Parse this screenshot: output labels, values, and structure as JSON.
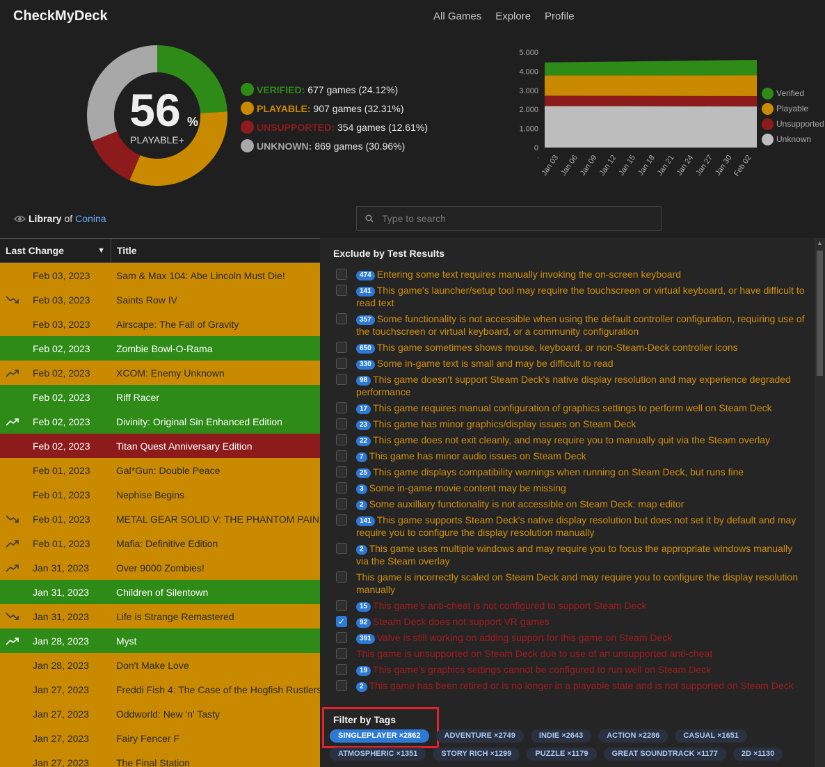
{
  "header": {
    "brand": "CheckMyDeck",
    "nav": [
      "All Games",
      "Explore",
      "Profile"
    ]
  },
  "summary": {
    "percent": "56",
    "percent_sign": "%",
    "label": "PLAYABLE+",
    "stats": [
      {
        "label": "VERIFIED:",
        "value": "677 games (24.12%)",
        "color": "#2e8b17"
      },
      {
        "label": "PLAYABLE:",
        "value": "907 games (32.31%)",
        "color": "#c98a00"
      },
      {
        "label": "UNSUPPORTED:",
        "value": "354 games (12.61%)",
        "color": "#8e1b1b"
      },
      {
        "label": "UNKNOWN:",
        "value": "869 games (30.96%)",
        "color": "#a8a8a8"
      }
    ]
  },
  "chart_data": {
    "type": "area",
    "stacked": true,
    "x": [
      "Jan 03",
      "Jan 06",
      "Jan 09",
      "Jan 12",
      "Jan 15",
      "Jan 18",
      "Jan 21",
      "Jan 24",
      "Jan 27",
      "Jan 30",
      "Feb 02"
    ],
    "yticks": [
      "5.000",
      "4.000",
      "3.000",
      "2.000",
      "1.000",
      "0"
    ],
    "ylim": [
      0,
      5000
    ],
    "series": [
      {
        "name": "Unknown",
        "color": "#bdbdbd",
        "start": 2180,
        "end": 2160
      },
      {
        "name": "Unsupported",
        "color": "#8e1b1b",
        "start": 540,
        "end": 540
      },
      {
        "name": "Playable",
        "color": "#c98a00",
        "start": 1060,
        "end": 1090
      },
      {
        "name": "Verified",
        "color": "#2e8b17",
        "start": 680,
        "end": 810
      }
    ],
    "legend": [
      "Verified",
      "Playable",
      "Unsupported",
      "Unknown"
    ]
  },
  "library": {
    "prefix": "Library",
    "of": "of",
    "owner": "Conina"
  },
  "search": {
    "placeholder": "Type to search"
  },
  "table": {
    "col_date": "Last Change",
    "col_title": "Title",
    "rows": [
      {
        "date": "Feb 03, 2023",
        "title": "Sam & Max 104: Abe Lincoln Must Die!",
        "status": "playable",
        "trend": ""
      },
      {
        "date": "Feb 03, 2023",
        "title": "Saints Row IV",
        "status": "playable",
        "trend": "down"
      },
      {
        "date": "Feb 03, 2023",
        "title": "Airscape: The Fall of Gravity",
        "status": "playable",
        "trend": ""
      },
      {
        "date": "Feb 02, 2023",
        "title": "Zombie Bowl-O-Rama",
        "status": "verified",
        "trend": ""
      },
      {
        "date": "Feb 02, 2023",
        "title": "XCOM: Enemy Unknown",
        "status": "playable",
        "trend": "up"
      },
      {
        "date": "Feb 02, 2023",
        "title": "Riff Racer",
        "status": "verified",
        "trend": ""
      },
      {
        "date": "Feb 02, 2023",
        "title": "Divinity: Original Sin Enhanced Edition",
        "status": "verified",
        "trend": "up"
      },
      {
        "date": "Feb 02, 2023",
        "title": "Titan Quest Anniversary Edition",
        "status": "unsupported",
        "trend": ""
      },
      {
        "date": "Feb 01, 2023",
        "title": "Gal*Gun: Double Peace",
        "status": "playable",
        "trend": ""
      },
      {
        "date": "Feb 01, 2023",
        "title": "Nephise Begins",
        "status": "playable",
        "trend": ""
      },
      {
        "date": "Feb 01, 2023",
        "title": "METAL GEAR SOLID V: THE PHANTOM PAIN",
        "status": "playable",
        "trend": "down"
      },
      {
        "date": "Feb 01, 2023",
        "title": "Mafia: Definitive Edition",
        "status": "playable",
        "trend": "up"
      },
      {
        "date": "Jan 31, 2023",
        "title": "Over 9000 Zombies!",
        "status": "playable",
        "trend": "up"
      },
      {
        "date": "Jan 31, 2023",
        "title": "Children of Silentown",
        "status": "verified",
        "trend": ""
      },
      {
        "date": "Jan 31, 2023",
        "title": "Life is Strange Remastered",
        "status": "playable",
        "trend": "down"
      },
      {
        "date": "Jan 28, 2023",
        "title": "Myst",
        "status": "verified",
        "trend": "up"
      },
      {
        "date": "Jan 28, 2023",
        "title": "Don't Make Love",
        "status": "playable",
        "trend": ""
      },
      {
        "date": "Jan 27, 2023",
        "title": "Freddi Fish 4: The Case of the Hogfish Rustlers",
        "status": "playable",
        "trend": ""
      },
      {
        "date": "Jan 27, 2023",
        "title": "Oddworld: New 'n' Tasty",
        "status": "playable",
        "trend": ""
      },
      {
        "date": "Jan 27, 2023",
        "title": "Fairy Fencer F",
        "status": "playable",
        "trend": ""
      },
      {
        "date": "Jan 27, 2023",
        "title": "The Final Station",
        "status": "playable",
        "trend": ""
      }
    ]
  },
  "filters": {
    "exclude_title": "Exclude by Test Results",
    "items": [
      {
        "count": "474",
        "text": "Entering some text requires manually invoking the on-screen keyboard",
        "kind": "playable",
        "checked": false
      },
      {
        "count": "141",
        "text": "This game's launcher/setup tool may require the touchscreen or virtual keyboard, or have difficult to read text",
        "kind": "playable",
        "checked": false
      },
      {
        "count": "357",
        "text": "Some functionality is not accessible when using the default controller configuration, requiring use of the touchscreen or virtual keyboard, or a community configuration",
        "kind": "playable",
        "checked": false
      },
      {
        "count": "650",
        "text": "This game sometimes shows mouse, keyboard, or non-Steam-Deck controller icons",
        "kind": "playable",
        "checked": false
      },
      {
        "count": "330",
        "text": "Some in-game text is small and may be difficult to read",
        "kind": "playable",
        "checked": false
      },
      {
        "count": "98",
        "text": "This game doesn't support Steam Deck's native display resolution and may experience degraded performance",
        "kind": "playable",
        "checked": false
      },
      {
        "count": "17",
        "text": "This game requires manual configuration of graphics settings to perform well on Steam Deck",
        "kind": "playable",
        "checked": false
      },
      {
        "count": "23",
        "text": "This game has minor graphics/display issues on Steam Deck",
        "kind": "playable",
        "checked": false
      },
      {
        "count": "22",
        "text": "This game does not exit cleanly, and may require you to manually quit via the Steam overlay",
        "kind": "playable",
        "checked": false
      },
      {
        "count": "7",
        "text": "This game has minor audio issues on Steam Deck",
        "kind": "playable",
        "checked": false
      },
      {
        "count": "25",
        "text": "This game displays compatibility warnings when running on Steam Deck, but runs fine",
        "kind": "playable",
        "checked": false
      },
      {
        "count": "3",
        "text": "Some in-game movie content may be missing",
        "kind": "playable",
        "checked": false
      },
      {
        "count": "2",
        "text": "Some auxilliary functionality is not accessible on Steam Deck: map editor",
        "kind": "playable",
        "checked": false
      },
      {
        "count": "141",
        "text": "This game supports Steam Deck's native display resolution but does not set it by default and may require you to configure the display resolution manually",
        "kind": "playable",
        "checked": false
      },
      {
        "count": "2",
        "text": "This game uses multiple windows and may require you to focus the appropriate windows manually via the Steam overlay",
        "kind": "playable",
        "checked": false
      },
      {
        "count": "",
        "text": "This game is incorrectly scaled on Steam Deck and may require you to configure the display resolution manually",
        "kind": "playable",
        "checked": false
      },
      {
        "count": "15",
        "text": "This game's anti-cheat is not configured to support Steam Deck",
        "kind": "unsupported",
        "checked": false
      },
      {
        "count": "92",
        "text": "Steam Deck does not support VR games",
        "kind": "unsupported",
        "checked": true
      },
      {
        "count": "391",
        "text": "Valve is still working on adding support for this game on Steam Deck",
        "kind": "unsupported",
        "checked": false
      },
      {
        "count": "",
        "text": "This game is unsupported on Steam Deck due to use of an unsupported anti-cheat",
        "kind": "unsupported",
        "checked": false
      },
      {
        "count": "19",
        "text": "This game's graphics settings cannot be configured to run well on Steam Deck",
        "kind": "unsupported",
        "checked": false
      },
      {
        "count": "2",
        "text": "This game has been retired or is no longer in a playable state and is not supported on Steam Deck",
        "kind": "unsupported",
        "checked": false
      }
    ],
    "tags_title": "Filter by Tags",
    "tags": [
      {
        "label": "SINGLEPLAYER ×2862",
        "selected": true
      },
      {
        "label": "ADVENTURE ×2749",
        "selected": false
      },
      {
        "label": "INDIE ×2643",
        "selected": false
      },
      {
        "label": "ACTION ×2286",
        "selected": false
      },
      {
        "label": "CASUAL ×1651",
        "selected": false
      },
      {
        "label": "ATMOSPHERIC ×1351",
        "selected": false
      },
      {
        "label": "STORY RICH ×1299",
        "selected": false
      },
      {
        "label": "PUZZLE ×1179",
        "selected": false
      },
      {
        "label": "GREAT SOUNDTRACK ×1177",
        "selected": false
      },
      {
        "label": "2D ×1130",
        "selected": false
      }
    ]
  },
  "colors": {
    "verified": "#2e8b17",
    "playable": "#c98a00",
    "unsupported": "#8e1b1b",
    "unknown": "#a8a8a8",
    "playable_text": "#d08f0c",
    "unsupported_text": "#a11d1d"
  }
}
